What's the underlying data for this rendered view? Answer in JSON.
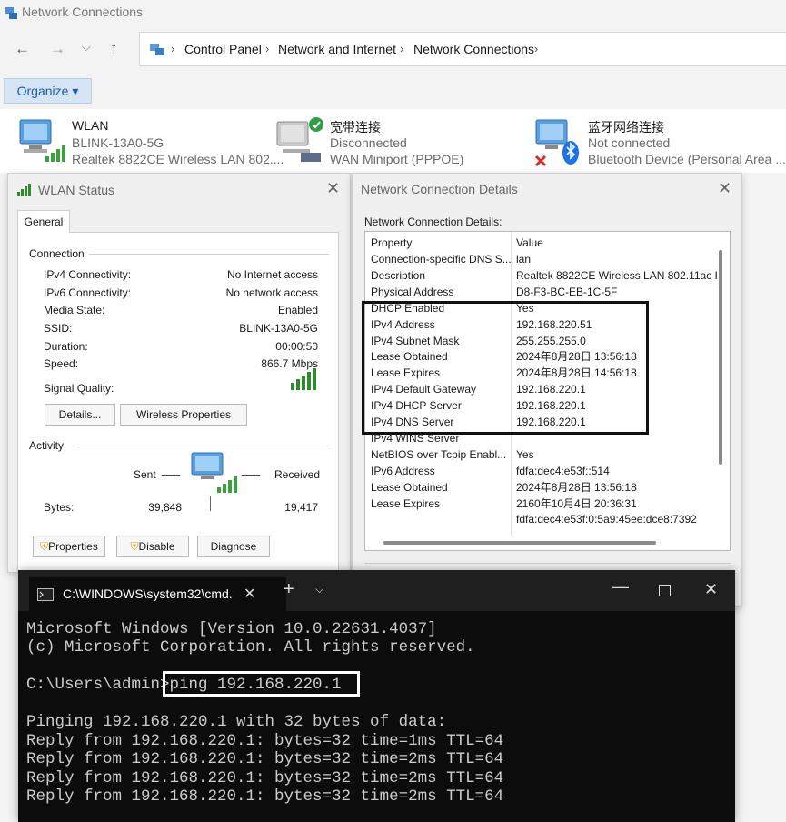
{
  "explorer": {
    "title": "Network Connections",
    "breadcrumbs": [
      "Control Panel",
      "Network and Internet",
      "Network Connections"
    ],
    "organize_label": "Organize ▾"
  },
  "connections": [
    {
      "name": "WLAN",
      "status": "BLINK-13A0-5G",
      "device": "Realtek 8822CE Wireless LAN 802...."
    },
    {
      "name": "宽带连接",
      "status": "Disconnected",
      "device": "WAN Miniport (PPPOE)"
    },
    {
      "name": "蓝牙网络连接",
      "status": "Not connected",
      "device": "Bluetooth Device (Personal Area ..."
    }
  ],
  "wlan_status": {
    "title": "WLAN Status",
    "tab": "General",
    "connection_group": "Connection",
    "rows": [
      {
        "label": "IPv4 Connectivity:",
        "value": "No Internet access"
      },
      {
        "label": "IPv6 Connectivity:",
        "value": "No network access"
      },
      {
        "label": "Media State:",
        "value": "Enabled"
      },
      {
        "label": "SSID:",
        "value": "BLINK-13A0-5G"
      },
      {
        "label": "Duration:",
        "value": "00:00:50"
      },
      {
        "label": "Speed:",
        "value": "866.7 Mbps"
      }
    ],
    "signal_label": "Signal Quality:",
    "signal_level_bars": 5,
    "details_btn": "Details...",
    "wireless_btn": "Wireless Properties",
    "activity_group": "Activity",
    "sent_label": "Sent",
    "received_label": "Received",
    "bytes_label": "Bytes:",
    "bytes_sent": "39,848",
    "bytes_received": "19,417",
    "properties_btn": "Properties",
    "disable_btn": "Disable",
    "diagnose_btn": "Diagnose"
  },
  "details": {
    "title": "Network Connection Details",
    "subtitle": "Network Connection Details:",
    "col_property": "Property",
    "col_value": "Value",
    "rows": [
      {
        "p": "Connection-specific DNS S...",
        "v": "lan"
      },
      {
        "p": "Description",
        "v": "Realtek 8822CE Wireless LAN 802.11ac I"
      },
      {
        "p": "Physical Address",
        "v": "D8-F3-BC-EB-1C-5F"
      },
      {
        "p": "DHCP Enabled",
        "v": "Yes"
      },
      {
        "p": "IPv4 Address",
        "v": "192.168.220.51"
      },
      {
        "p": "IPv4 Subnet Mask",
        "v": "255.255.255.0"
      },
      {
        "p": "Lease Obtained",
        "v": "2024年8月28日 13:56:18"
      },
      {
        "p": "Lease Expires",
        "v": "2024年8月28日 14:56:18"
      },
      {
        "p": "IPv4 Default Gateway",
        "v": "192.168.220.1"
      },
      {
        "p": "IPv4 DHCP Server",
        "v": "192.168.220.1"
      },
      {
        "p": "IPv4 DNS Server",
        "v": "192.168.220.1"
      },
      {
        "p": "IPv4 WINS Server",
        "v": ""
      },
      {
        "p": "NetBIOS over Tcpip Enabl...",
        "v": "Yes"
      },
      {
        "p": "IPv6 Address",
        "v": "fdfa:dec4:e53f::514"
      },
      {
        "p": "Lease Obtained",
        "v": "2024年8月28日 13:56:18"
      },
      {
        "p": "Lease Expires",
        "v": "2160年10月4日 20:36:31"
      },
      {
        "p": "",
        "v": "fdfa:dec4:e53f:0:5a9:45ee:dce8:7392"
      }
    ]
  },
  "cmd": {
    "tab_title": "C:\\WINDOWS\\system32\\cmd.",
    "lines": [
      "Microsoft Windows [Version 10.0.22631.4037]",
      "(c) Microsoft Corporation. All rights reserved.",
      "",
      "C:\\Users\\admin>ping 192.168.220.1",
      "",
      "Pinging 192.168.220.1 with 32 bytes of data:",
      "Reply from 192.168.220.1: bytes=32 time=1ms TTL=64",
      "Reply from 192.168.220.1: bytes=32 time=2ms TTL=64",
      "Reply from 192.168.220.1: bytes=32 time=2ms TTL=64",
      "Reply from 192.168.220.1: bytes=32 time=2ms TTL=64"
    ]
  }
}
